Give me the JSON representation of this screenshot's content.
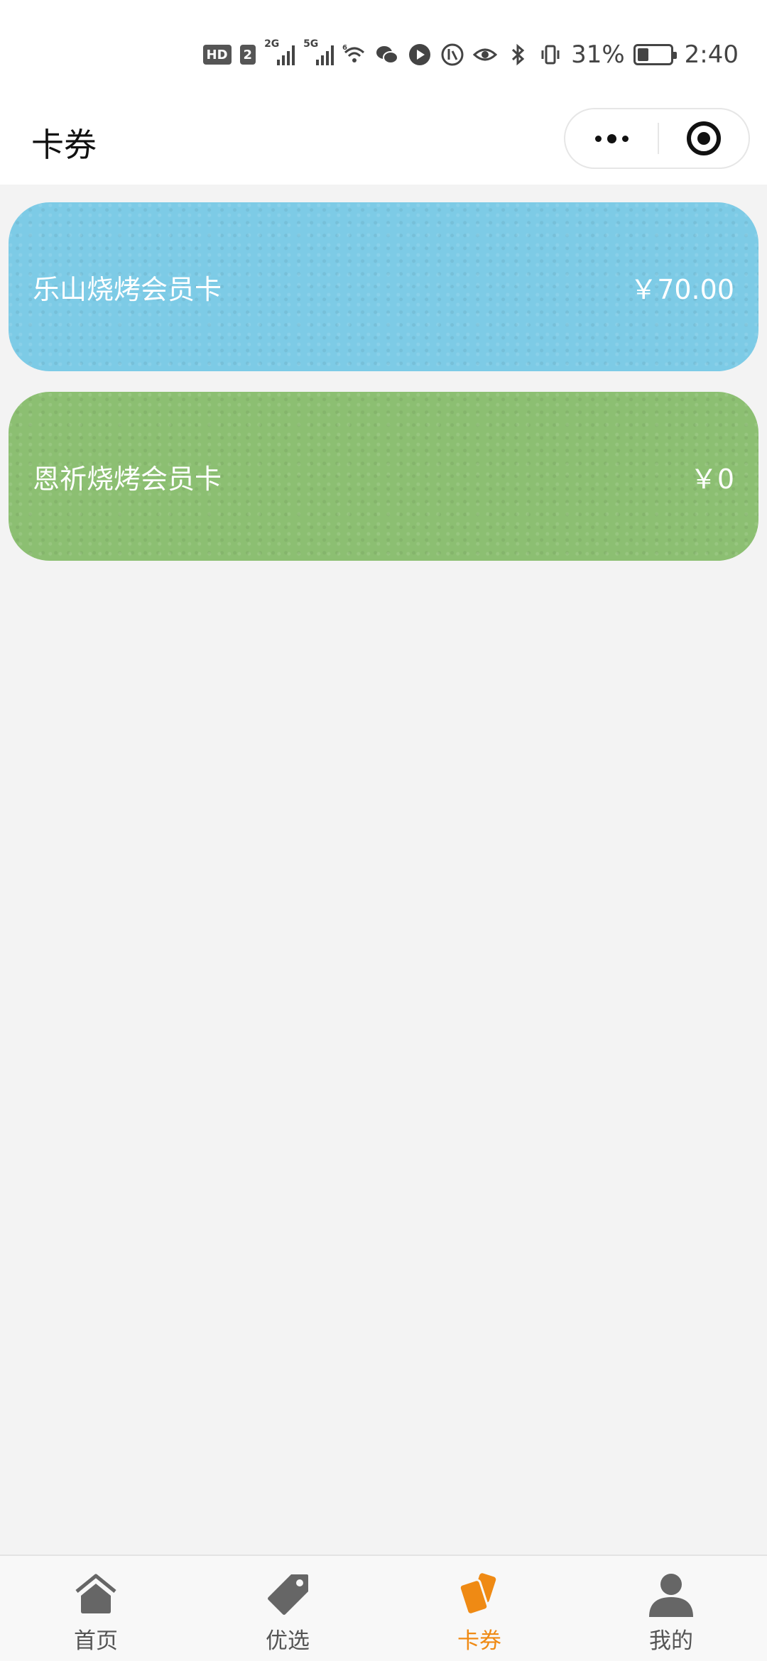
{
  "status_bar": {
    "hd_label": "HD",
    "sim_label": "2",
    "net1": "2G",
    "net2": "5G",
    "wifi_gen": "6",
    "battery_percent": "31%",
    "battery_level": 0.31,
    "time": "2:40"
  },
  "header": {
    "title": "卡券"
  },
  "cards": [
    {
      "name": "乐山烧烤会员卡",
      "amount": "￥70.00",
      "color": "#7dcbe6"
    },
    {
      "name": "恩祈烧烤会员卡",
      "amount": "￥0",
      "color": "#8cbf72"
    }
  ],
  "tabbar": {
    "active_color": "#ef8a14",
    "inactive_color": "#555555",
    "items": [
      {
        "label": "首页",
        "icon": "home-icon"
      },
      {
        "label": "优选",
        "icon": "tag-icon"
      },
      {
        "label": "卡券",
        "icon": "cards-icon"
      },
      {
        "label": "我的",
        "icon": "user-icon"
      }
    ]
  }
}
